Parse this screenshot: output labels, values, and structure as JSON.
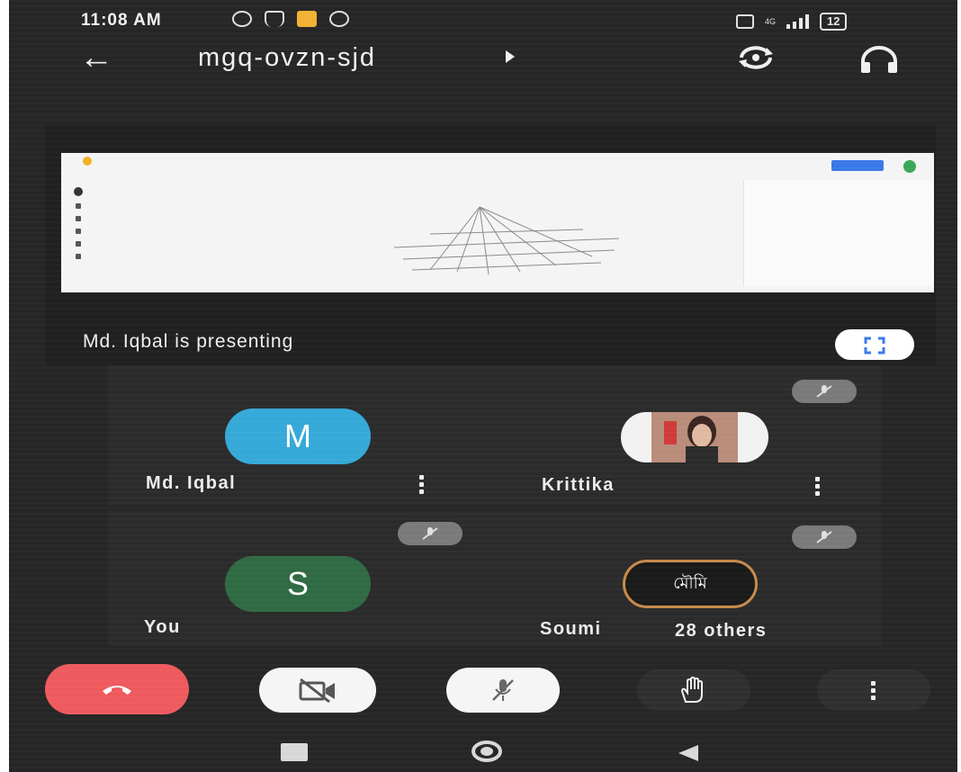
{
  "status_bar": {
    "time": "11:08 AM",
    "network": "4G",
    "battery": "12"
  },
  "app_bar": {
    "meeting_code": "mgq-ovzn-sjd"
  },
  "presentation": {
    "presenting_label": "Md. Iqbal is presenting"
  },
  "participants": [
    {
      "name": "Md. Iqbal",
      "initial": "M",
      "avatar_color": "#35a9d8",
      "muted": false
    },
    {
      "name": "Krittika",
      "initial": "",
      "avatar_color": "#f2f2f2",
      "muted": true
    },
    {
      "name": "You",
      "initial": "S",
      "avatar_color": "#2f6a43",
      "muted": true
    },
    {
      "name": "Soumi",
      "initial": "",
      "avatar_color": "#1a1a1a",
      "muted": true,
      "avatar_text": "মৌমি"
    }
  ],
  "others_count_label": "28 others",
  "colors": {
    "end_call": "#ee5a5e",
    "background": "#262626",
    "battery_accent": "#f2b233"
  }
}
